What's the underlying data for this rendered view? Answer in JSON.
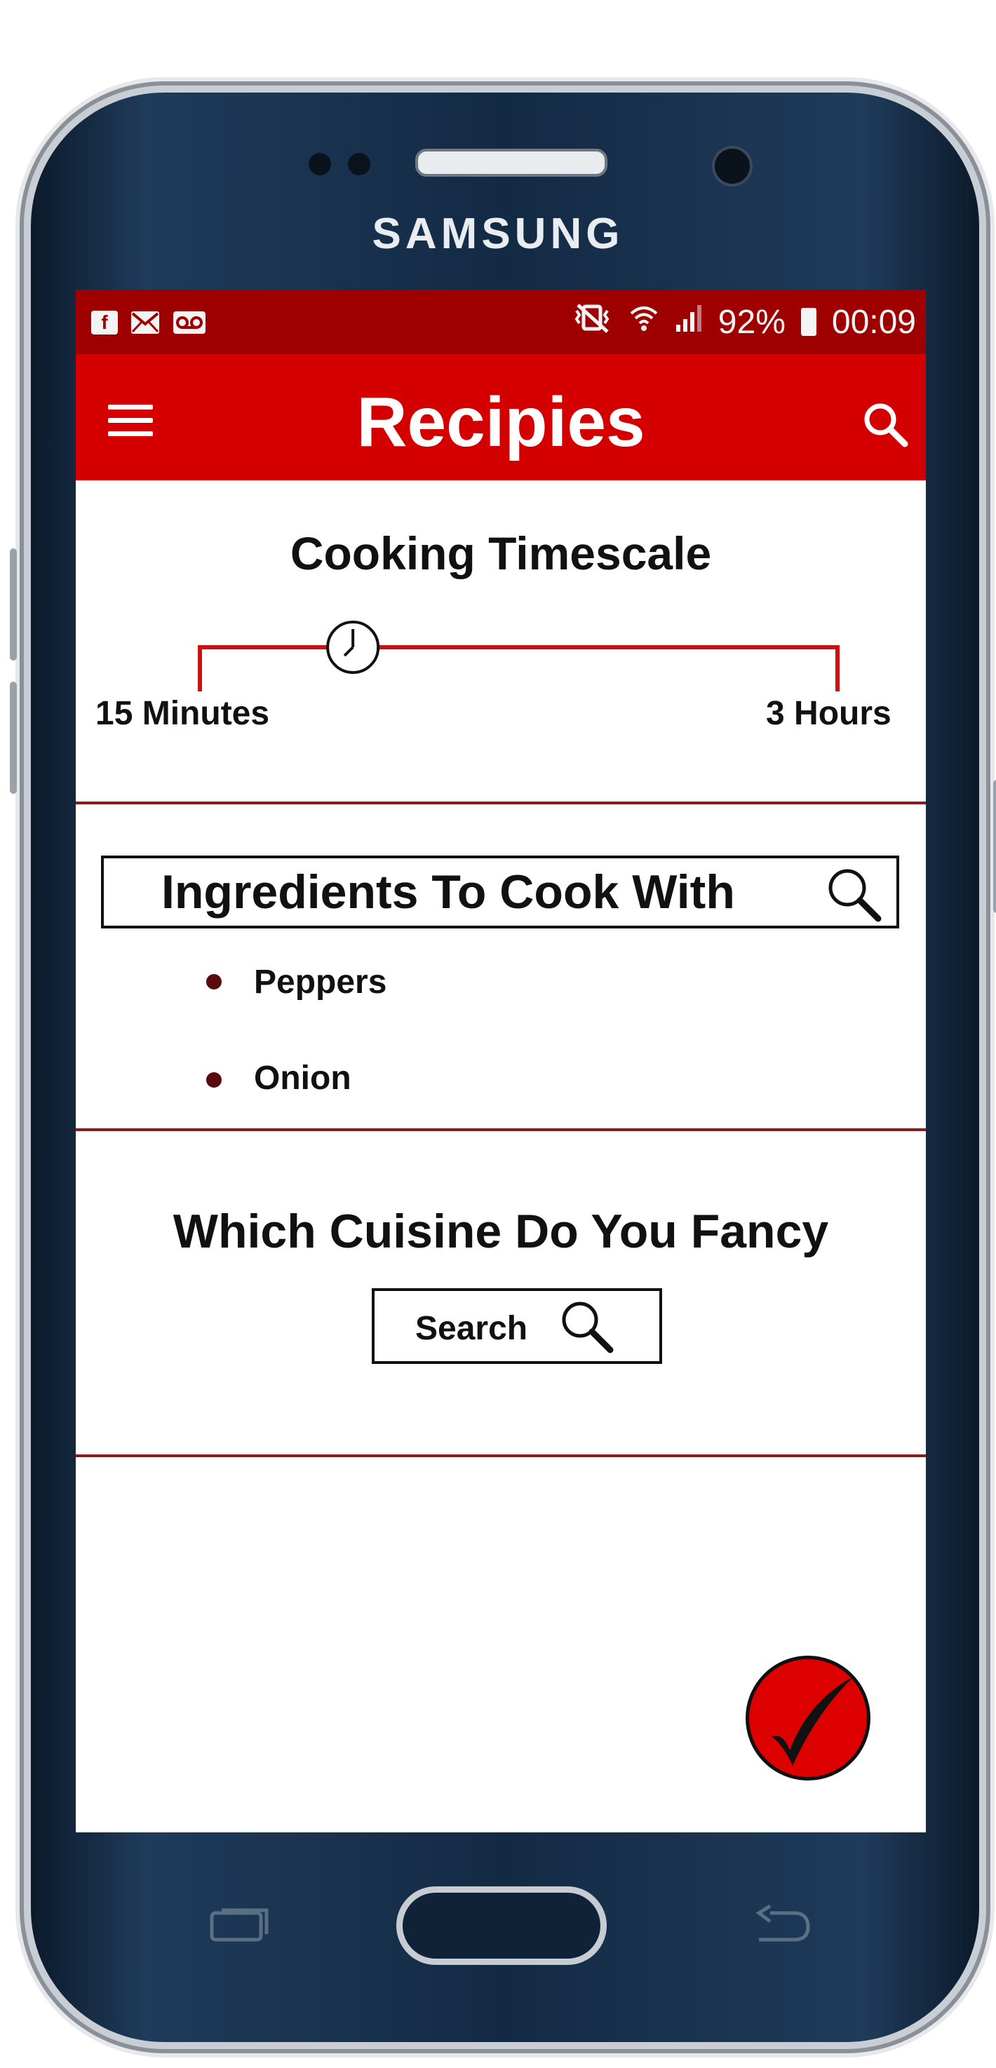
{
  "device": {
    "brand": "SAMSUNG"
  },
  "status_bar": {
    "left_icons": [
      "facebook-icon",
      "email-icon",
      "voicemail-icon"
    ],
    "right_icons": [
      "mute-vibrate-icon",
      "wifi-icon",
      "signal-icon",
      "battery-icon"
    ],
    "battery": "92%",
    "time": "00:09"
  },
  "app_bar": {
    "title": "Recipies",
    "menu_icon": "hamburger-menu-icon",
    "search_icon": "search-icon"
  },
  "timescale": {
    "title": "Cooking Timescale",
    "min_label": "15 Minutes",
    "max_label": "3 Hours",
    "slider_position": 0.24,
    "handle_icon": "clock-icon"
  },
  "ingredients": {
    "title": "Ingredients To Cook With",
    "search_icon": "magnifier-icon",
    "items": [
      "Peppers",
      "Onion"
    ]
  },
  "cuisine": {
    "title": "Which Cuisine Do You Fancy",
    "search_label": "Search",
    "search_icon": "magnifier-icon"
  },
  "fab": {
    "icon": "checkmark-icon"
  },
  "colors": {
    "status_bar": "#9e0000",
    "app_bar": "#d40000",
    "divider": "#8b1a1a",
    "fab": "#dd0000"
  }
}
